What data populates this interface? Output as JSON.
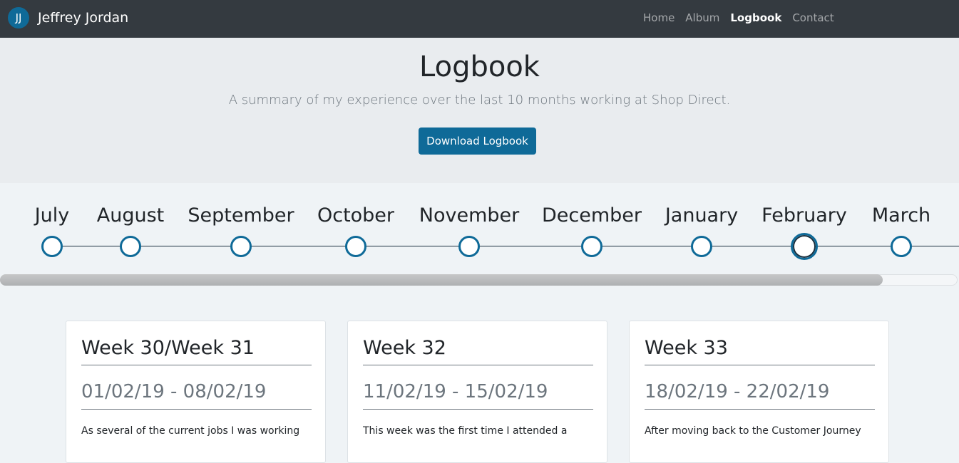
{
  "brand": {
    "logo_text": "JJ",
    "name": "Jeffrey Jordan"
  },
  "nav": {
    "items": [
      {
        "label": "Home",
        "active": false
      },
      {
        "label": "Album",
        "active": false
      },
      {
        "label": "Logbook",
        "active": true
      },
      {
        "label": "Contact",
        "active": false
      }
    ]
  },
  "jumbotron": {
    "title": "Logbook",
    "lead": "A summary of my experience over the last 10 months working at Shop Direct.",
    "button_label": "Download Logbook"
  },
  "timeline": {
    "months": [
      {
        "label": "July"
      },
      {
        "label": "August"
      },
      {
        "label": "September"
      },
      {
        "label": "October"
      },
      {
        "label": "November"
      },
      {
        "label": "December"
      },
      {
        "label": "January"
      },
      {
        "label": "February",
        "current": true
      },
      {
        "label": "March"
      }
    ]
  },
  "cards": [
    {
      "title": "Week 30/Week 31",
      "dates": "01/02/19 - 08/02/19",
      "excerpt": "As several of the current jobs I was working"
    },
    {
      "title": "Week 32",
      "dates": "11/02/19 - 15/02/19",
      "excerpt": "This week was the first time I attended a"
    },
    {
      "title": "Week 33",
      "dates": "18/02/19 - 22/02/19",
      "excerpt": "After moving back to the Customer Journey"
    }
  ],
  "colors": {
    "navbar": "#343a40",
    "accent": "#0f6a98",
    "jumbotron": "#e9ecef",
    "page": "#eff3f6"
  }
}
